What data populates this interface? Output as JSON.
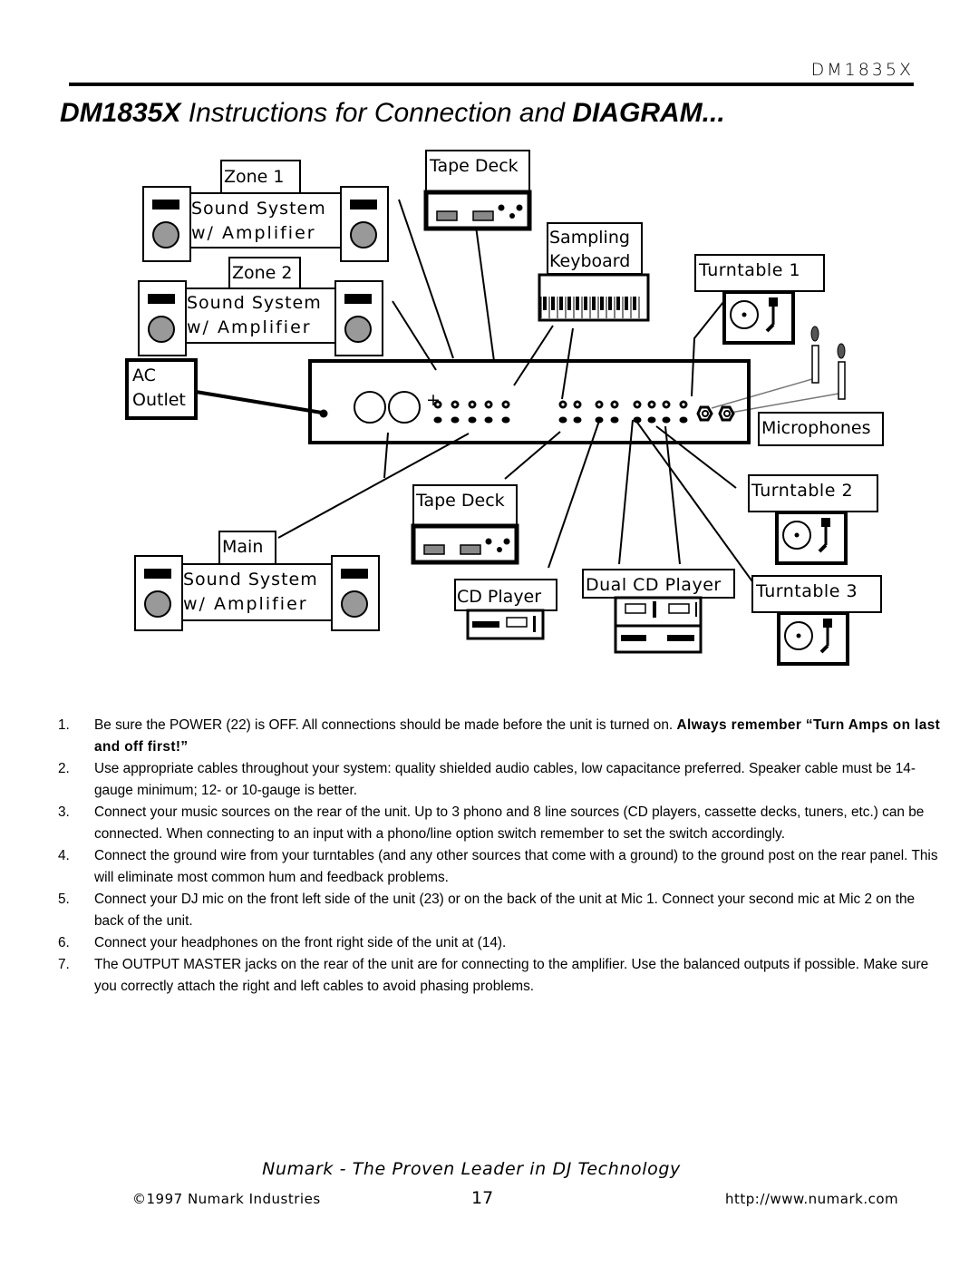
{
  "header": {
    "model": "DM1835X",
    "title_bold_1": "DM1835X",
    "title_regular": " Instructions for Connection and ",
    "title_bold_2": "DIAGRAM..."
  },
  "diagram": {
    "zone1": {
      "label": "Zone 1",
      "line1": "Sound System",
      "line2": "w/ Amplifier"
    },
    "zone2": {
      "label": "Zone 2",
      "line1": "Sound System",
      "line2": "w/ Amplifier"
    },
    "main": {
      "label": "Main",
      "line1": "Sound System",
      "line2": "w/ Amplifier"
    },
    "ac_outlet": {
      "line1": "AC",
      "line2": "Outlet"
    },
    "tape_deck_top": "Tape Deck",
    "tape_deck_bottom": "Tape Deck",
    "sampling_keyboard": {
      "line1": "Sampling",
      "line2": "Keyboard"
    },
    "turntable1": "Turntable 1",
    "turntable2": "Turntable 2",
    "turntable3": "Turntable 3",
    "microphones": "Microphones",
    "cd_player": "CD Player",
    "dual_cd_player": "Dual CD Player"
  },
  "instructions": [
    {
      "num": "1.",
      "text": "Be sure the POWER (22) is OFF.  All connections should be made before the unit is turned on.  ",
      "strong": "Always remember “Turn Amps on last and off first!”"
    },
    {
      "num": "2.",
      "text": "Use appropriate cables throughout your system: quality shielded audio cables, low capacitance preferred.  Speaker cable must be 14-gauge minimum; 12- or 10-gauge is better.",
      "strong": ""
    },
    {
      "num": "3.",
      "text": "Connect your music sources on the rear of the unit.  Up to 3 phono and 8 line sources (CD players, cassette decks, tuners, etc.) can be connected.   When connecting to an input with a phono/line option switch remember to set the switch accordingly.",
      "strong": ""
    },
    {
      "num": "4.",
      "text": "Connect the ground wire from your turntables (and any other sources that come with a ground) to the ground post on the rear panel.  This will eliminate most common hum and feedback problems.",
      "strong": ""
    },
    {
      "num": "5.",
      "text": "Connect your DJ mic on the front left side of the unit (23) or on the back of the unit at Mic 1.  Connect your second mic at Mic 2 on the back of the unit.",
      "strong": ""
    },
    {
      "num": "6.",
      "text": "Connect your headphones on the front right side of the unit at (14).",
      "strong": ""
    },
    {
      "num": "7.",
      "text": "The OUTPUT MASTER jacks on the rear of the unit are for connecting to the amplifier.  Use the balanced outputs if possible.  Make sure you correctly attach the right and left cables to avoid phasing problems.",
      "strong": ""
    }
  ],
  "footer": {
    "tagline": "Numark - The Proven Leader in DJ Technology",
    "copyright": "©1997 Numark Industries",
    "page_number": "17",
    "url": "http://www.numark.com"
  }
}
